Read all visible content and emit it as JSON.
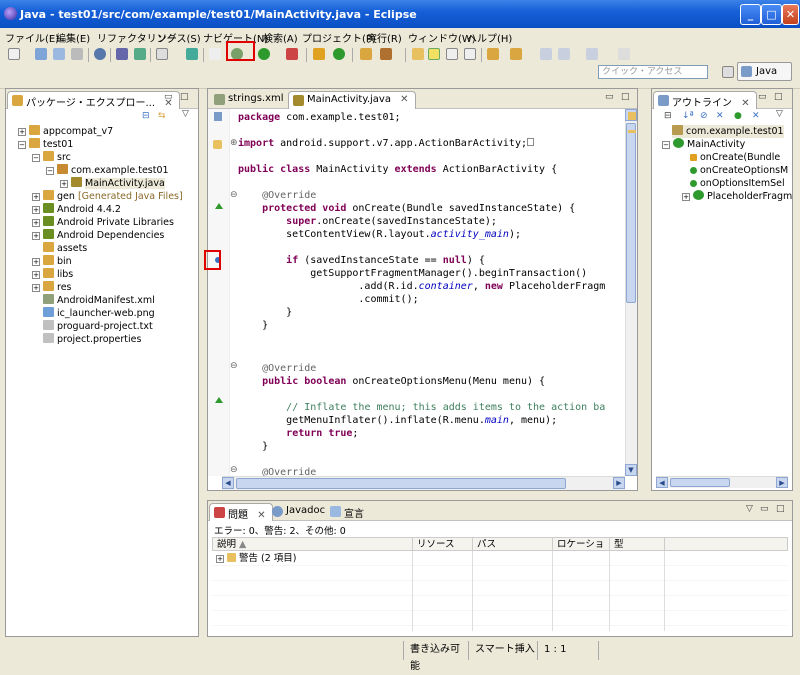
{
  "window": {
    "title": "Java - test01/src/com/example/test01/MainActivity.java - Eclipse",
    "min": "_",
    "max": "□",
    "close": "✕"
  },
  "menubar": [
    "ファイル(E)",
    "編集(E)",
    "リファクタリング",
    "ソース(S)",
    "ナビゲート(N)",
    "検索(A)",
    "プロジェクト(P)",
    "実行(R)",
    "ウィンドウ(W)",
    "ヘルプ(H)"
  ],
  "toolbar": {
    "quick_access_placeholder": "クイック・アクセス",
    "perspective": "Java"
  },
  "explorer": {
    "title": "パッケージ・エクスプロー...",
    "items": [
      {
        "label": "appcompat_v7",
        "color": "#d9a640"
      },
      {
        "label": "test01",
        "color": "#d9a640"
      },
      {
        "label": "src",
        "color": "#d9a640"
      },
      {
        "label": "com.example.test01",
        "color": "#c88a30"
      },
      {
        "label": "MainActivity.java",
        "color": "#a38a2c"
      },
      {
        "label": "gen",
        "extra": "[Generated Java Files]",
        "color": "#d9a640"
      },
      {
        "label": "Android 4.4.2",
        "color": "#6b8e23"
      },
      {
        "label": "Android Private Libraries",
        "color": "#6b8e23"
      },
      {
        "label": "Android Dependencies",
        "color": "#6b8e23"
      },
      {
        "label": "assets",
        "color": "#d9a640"
      },
      {
        "label": "bin",
        "color": "#d9a640"
      },
      {
        "label": "libs",
        "color": "#d9a640"
      },
      {
        "label": "res",
        "color": "#d9a640"
      },
      {
        "label": "AndroidManifest.xml",
        "color": "#8fa07a"
      },
      {
        "label": "ic_launcher-web.png",
        "color": "#6f9fd8"
      },
      {
        "label": "proguard-project.txt",
        "color": "#c0c0c0"
      },
      {
        "label": "project.properties",
        "color": "#c0c0c0"
      }
    ]
  },
  "editor": {
    "tabs": [
      "strings.xml",
      "MainActivity.java"
    ],
    "tab_close": "✕"
  },
  "outline": {
    "title": "アウトライン",
    "items": [
      "com.example.test01",
      "MainActivity",
      "onCreate(Bundle",
      "onCreateOptionsM",
      "onOptionsItemSel",
      "PlaceholderFragm"
    ]
  },
  "problems": {
    "tabs": [
      "問題",
      "Javadoc",
      "宣言"
    ],
    "summary": "エラー: 0、警告: 2、その他: 0",
    "columns": [
      "説明",
      "リソース",
      "パス",
      "ロケーション",
      "型"
    ],
    "rows": [
      {
        "label": "警告 (2 項目)"
      }
    ]
  },
  "statusbar": [
    "書き込み可能",
    "スマート挿入",
    "1 : 1"
  ]
}
